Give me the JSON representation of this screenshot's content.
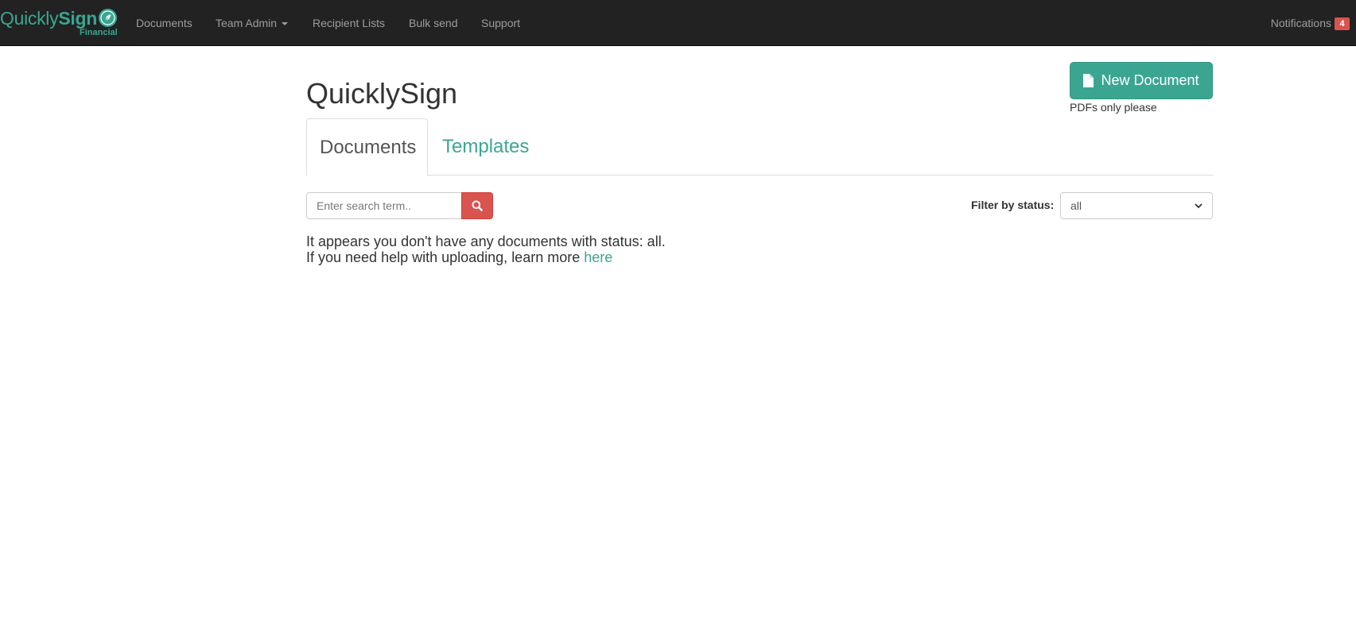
{
  "brand": {
    "name_light": "Quickly",
    "name_bold": "Sign",
    "subtitle": "Financial"
  },
  "nav": {
    "items": [
      {
        "label": "Documents"
      },
      {
        "label": "Team Admin"
      },
      {
        "label": "Recipient Lists"
      },
      {
        "label": "Bulk send"
      },
      {
        "label": "Support"
      }
    ],
    "notifications": {
      "label": "Notifications",
      "count": "4"
    }
  },
  "page": {
    "title": "QuicklySign",
    "new_document_label": "New Document",
    "pdf_note": "PDFs only please"
  },
  "tabs": [
    {
      "label": "Documents",
      "active": true
    },
    {
      "label": "Templates",
      "active": false
    }
  ],
  "search": {
    "placeholder": "Enter search term.."
  },
  "filter": {
    "label": "Filter by status:",
    "selected": "all"
  },
  "message": {
    "line1": "It appears you don't have any documents with status: all.",
    "line2_prefix": "If you need help with uploading, learn more ",
    "link_label": "here"
  },
  "colors": {
    "brand": "#3aa692",
    "navbar": "#222222",
    "danger": "#d9534f"
  }
}
